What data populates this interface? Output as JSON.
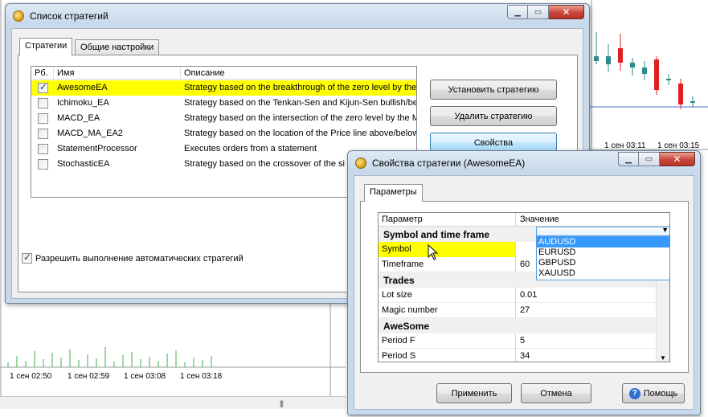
{
  "chart_bg": {
    "axis_labels_bottom": [
      "1 сен 02:50",
      "1 сен 02:59",
      "1 сен 03:08",
      "1 сен 03:18"
    ],
    "axis_labels_right": [
      "1 сен 03:11",
      "1 сен 03:15"
    ]
  },
  "strategies_window": {
    "title": "Список стратегий",
    "tabs": [
      "Стратегии",
      "Общие настройки"
    ],
    "columns": [
      "Рб.",
      "Имя",
      "Описание"
    ],
    "rows": [
      {
        "checked": true,
        "name": "AwesomeEA",
        "description": "Strategy based on the breakthrough of the zero level by the"
      },
      {
        "checked": false,
        "name": "Ichimoku_EA",
        "description": "Strategy based on the Tenkan-Sen and Kijun-Sen bullish/bea"
      },
      {
        "checked": false,
        "name": "MACD_EA",
        "description": "Strategy based on the intersection of the zero level by the M"
      },
      {
        "checked": false,
        "name": "MACD_MA_EA2",
        "description": "Strategy based on the location of the Price line above/below"
      },
      {
        "checked": false,
        "name": "StatementProcessor",
        "description": "Executes orders from a statement"
      },
      {
        "checked": false,
        "name": "StochasticEA",
        "description": "Strategy based on the crossover of the si"
      }
    ],
    "buttons": {
      "install": "Установить стратегию",
      "delete": "Удалить стратегию",
      "properties": "Свойства"
    },
    "allow_auto_label": "Разрешить выполнение автоматических стратегий",
    "allow_auto_checked": true
  },
  "props_window": {
    "title": "Свойства стратегии (AwesomeEA)",
    "tab": "Параметры",
    "columns": [
      "Параметр",
      "Значение"
    ],
    "categories": {
      "symbol_tf": "Symbol and time frame",
      "trades": "Trades",
      "awesome": "AweSome"
    },
    "params": {
      "symbol": {
        "name": "Symbol",
        "value": ""
      },
      "timeframe": {
        "name": "Timeframe",
        "value": "60"
      },
      "lot_size": {
        "name": "Lot size",
        "value": "0.01"
      },
      "magic_number": {
        "name": "Magic number",
        "value": "27"
      },
      "period_f": {
        "name": "Period F",
        "value": "5"
      },
      "period_s": {
        "name": "Period S",
        "value": "34"
      }
    },
    "symbol_options": [
      "AUDUSD",
      "EURUSD",
      "GBPUSD",
      "XAUUSD"
    ],
    "symbol_highlighted": "AUDUSD",
    "buttons": {
      "apply": "Применить",
      "cancel": "Отмена",
      "help": "Помощь"
    }
  },
  "colors": {
    "selection": "#ffff00",
    "highlight": "#3399ff",
    "candle_up": "#2e8b8b",
    "candle_down": "#e02020",
    "volume": "#3cb043"
  }
}
